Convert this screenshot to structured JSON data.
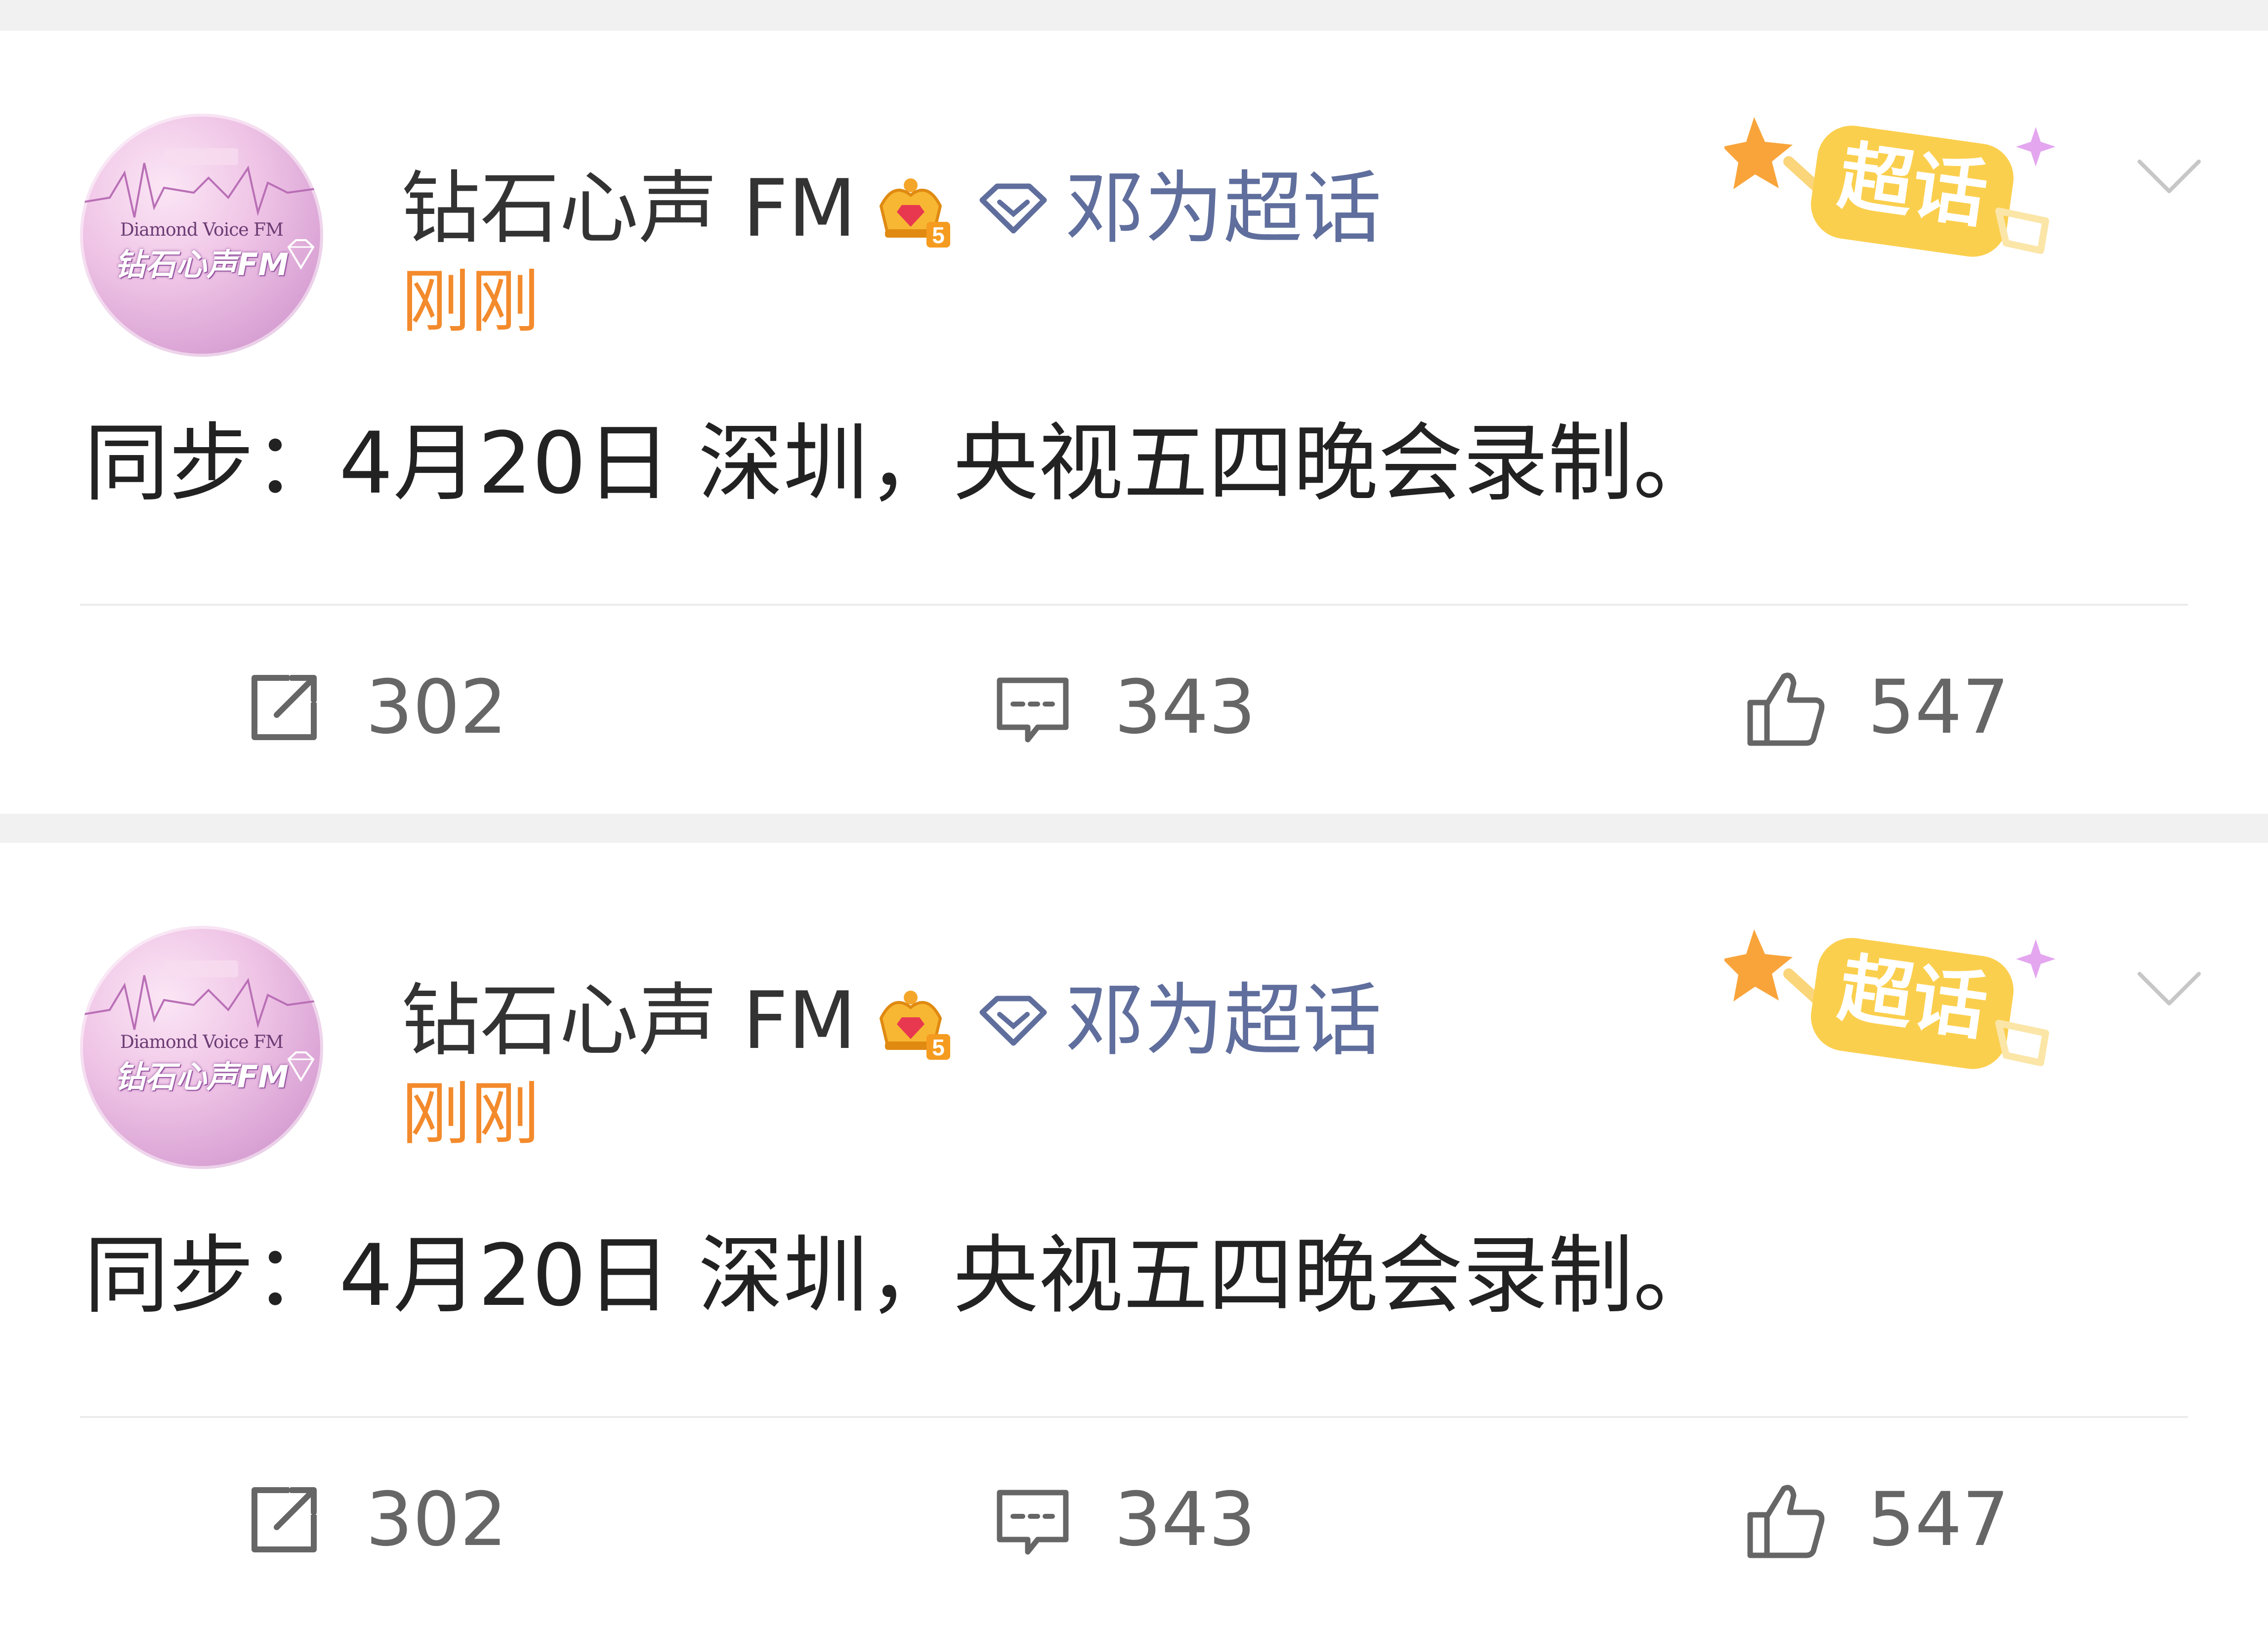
{
  "posts": [
    {
      "author": "钻石心声 FM",
      "avatar_text_en": "Diamond Voice FM",
      "avatar_text_cn": "钻石心声FM",
      "member_level": "5",
      "topic": "邓为超话",
      "time": "刚刚",
      "badge": "超话",
      "content": "同步：4月20日 深圳，央视五四晚会录制。",
      "reposts": "302",
      "comments": "343",
      "likes": "547"
    },
    {
      "author": "钻石心声 FM",
      "avatar_text_en": "Diamond Voice FM",
      "avatar_text_cn": "钻石心声FM",
      "member_level": "5",
      "topic": "邓为超话",
      "time": "刚刚",
      "badge": "超话",
      "content": "同步：4月20日 深圳，央视五四晚会录制。",
      "reposts": "302",
      "comments": "343",
      "likes": "547"
    }
  ],
  "colors": {
    "topic": "#5f6e9c",
    "time": "#f38a2c",
    "badge": "#f6c23e",
    "text": "#222222",
    "count": "#666666"
  },
  "icons": [
    "crown-icon",
    "diamond-tag-icon",
    "superchat-badge-icon",
    "chevron-down-icon",
    "repost-icon",
    "comment-icon",
    "like-icon"
  ]
}
